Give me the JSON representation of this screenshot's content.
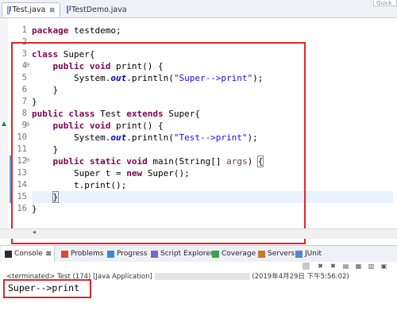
{
  "editor_tabs": [
    {
      "label": "Test.java",
      "close": "⊠",
      "active": true
    },
    {
      "label": "TestDemo.java",
      "active": false
    }
  ],
  "quick_access": "Quick",
  "code_lines": [
    {
      "n": "1"
    },
    {
      "n": "2"
    },
    {
      "n": "3"
    },
    {
      "n": "4"
    },
    {
      "n": "5"
    },
    {
      "n": "6"
    },
    {
      "n": "7"
    },
    {
      "n": "8"
    },
    {
      "n": "9"
    },
    {
      "n": "10"
    },
    {
      "n": "11"
    },
    {
      "n": "12"
    },
    {
      "n": "13"
    },
    {
      "n": "14"
    },
    {
      "n": "15"
    },
    {
      "n": "16"
    }
  ],
  "code": {
    "l1_kw": "package",
    "l1_rest": " testdemo;",
    "l3_kw": "class",
    "l3_rest": " Super{",
    "l4_kw1": "public",
    "l4_kw2": "void",
    "l4_rest": " print() {",
    "l5_a": "System.",
    "l5_out": "out",
    "l5_b": ".println(",
    "l5_str": "\"Super-->print\"",
    "l5_c": ");",
    "l6": "}",
    "l7": "}",
    "l8_kw1": "public",
    "l8_kw2": "class",
    "l8_mid": " Test ",
    "l8_kw3": "extends",
    "l8_rest": " Super{",
    "l9_kw1": "public",
    "l9_kw2": "void",
    "l9_rest": " print() {",
    "l10_a": "System.",
    "l10_out": "out",
    "l10_b": ".println(",
    "l10_str": "\"Test-->print\"",
    "l10_c": ");",
    "l11": "}",
    "l12_kw1": "public",
    "l12_kw2": "static",
    "l12_kw3": "void",
    "l12_mid": " main(String[] ",
    "l12_param": "args",
    "l12_c": ") ",
    "l12_brace": "{",
    "l13_a": "Super t = ",
    "l13_kw": "new",
    "l13_b": " Super();",
    "l14": "t.print();",
    "l15": "}",
    "l16": "}"
  },
  "views": [
    {
      "label": "Console",
      "close": "⊠"
    },
    {
      "label": "Problems"
    },
    {
      "label": "Progress"
    },
    {
      "label": "Script Explorer"
    },
    {
      "label": "Coverage"
    },
    {
      "label": "Servers"
    },
    {
      "label": "JUnit"
    }
  ],
  "console": {
    "terminated_prefix": "<terminated> Test (174) [Java Application]",
    "terminated_suffix": "(2019年4月29日 下午5:56:02)",
    "output": "Super-->print"
  },
  "colors": {
    "highlight": "#e0262b",
    "keyword": "#7f0055",
    "string": "#2a00ff"
  }
}
